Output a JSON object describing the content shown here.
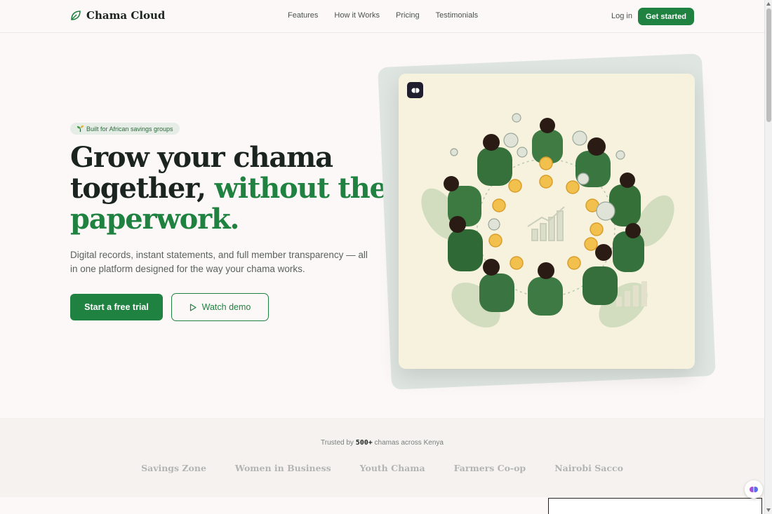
{
  "nav": {
    "logo_text": "Chama Cloud",
    "links": [
      "Features",
      "How it Works",
      "Pricing",
      "Testimonials"
    ],
    "login_label": "Log in",
    "cta_label": "Get started"
  },
  "hero": {
    "badge": "Built for African savings groups",
    "headline_line1": "Grow your chama",
    "headline_line2_dark": "together, ",
    "headline_line2_green": "without the",
    "headline_line3_green": "paperwork.",
    "subtext": "Digital records, instant statements, and full member transparency — all in one platform designed for the way your chama works.",
    "primary_cta": "Start a free trial",
    "secondary_cta": "Watch demo"
  },
  "trusted": {
    "prefix": "Trusted by ",
    "count": "500+",
    "suffix": " chamas across Kenya",
    "orgs": [
      "Savings Zone",
      "Women in Business",
      "Youth Chama",
      "Farmers Co-op",
      "Nairobi Sacco"
    ]
  },
  "colors": {
    "brand_green": "#1f8240",
    "background": "#fcf8f7",
    "card_bg": "#f7f2dd"
  },
  "icons": {
    "logo": "leaf-icon",
    "badge": "sprout-icon",
    "demo": "play-icon",
    "card": "brain-icon",
    "float": "brain-icon"
  }
}
